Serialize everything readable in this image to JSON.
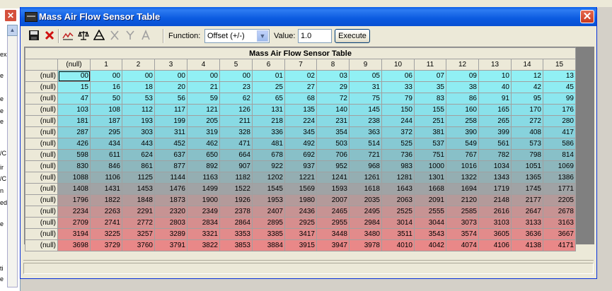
{
  "background": {
    "left_fragments": [
      "ex",
      "e",
      "e",
      "e",
      "e",
      "/C",
      "ir",
      "/C",
      "n",
      "ed",
      "e",
      "ti",
      "e"
    ]
  },
  "window": {
    "title": "Mass Air Flow Sensor Table",
    "close_glyph": "✕"
  },
  "toolbar": {
    "function_label": "Function:",
    "function_value": "Offset (+/-)",
    "value_label": "Value:",
    "value": "1.0",
    "execute_label": "Execute",
    "icons": [
      "save-icon",
      "delete-icon",
      "graph-icon",
      "balance-icon",
      "triangle-icon",
      "x-axis-icon",
      "y-axis-icon",
      "a-icon"
    ]
  },
  "table": {
    "caption": "Mass Air Flow Sensor Table",
    "corner_label": "(null)",
    "columns": [
      "1",
      "2",
      "3",
      "4",
      "5",
      "6",
      "7",
      "8",
      "9",
      "10",
      "11",
      "12",
      "13",
      "14",
      "15"
    ],
    "row_label": "(null)",
    "rows": [
      [
        "00",
        "00",
        "00",
        "00",
        "00",
        "00",
        "01",
        "02",
        "03",
        "05",
        "06",
        "07",
        "09",
        "10",
        "12",
        "13"
      ],
      [
        "15",
        "16",
        "18",
        "20",
        "21",
        "23",
        "25",
        "27",
        "29",
        "31",
        "33",
        "35",
        "38",
        "40",
        "42",
        "45"
      ],
      [
        "47",
        "50",
        "53",
        "56",
        "59",
        "62",
        "65",
        "68",
        "72",
        "75",
        "79",
        "83",
        "86",
        "91",
        "95",
        "99"
      ],
      [
        "103",
        "108",
        "112",
        "117",
        "121",
        "126",
        "131",
        "135",
        "140",
        "145",
        "150",
        "155",
        "160",
        "165",
        "170",
        "176"
      ],
      [
        "181",
        "187",
        "193",
        "199",
        "205",
        "211",
        "218",
        "224",
        "231",
        "238",
        "244",
        "251",
        "258",
        "265",
        "272",
        "280"
      ],
      [
        "287",
        "295",
        "303",
        "311",
        "319",
        "328",
        "336",
        "345",
        "354",
        "363",
        "372",
        "381",
        "390",
        "399",
        "408",
        "417"
      ],
      [
        "426",
        "434",
        "443",
        "452",
        "462",
        "471",
        "481",
        "492",
        "503",
        "514",
        "525",
        "537",
        "549",
        "561",
        "573",
        "586"
      ],
      [
        "598",
        "611",
        "624",
        "637",
        "650",
        "664",
        "678",
        "692",
        "706",
        "721",
        "736",
        "751",
        "767",
        "782",
        "798",
        "814"
      ],
      [
        "830",
        "846",
        "861",
        "877",
        "892",
        "907",
        "922",
        "937",
        "952",
        "968",
        "983",
        "1000",
        "1016",
        "1034",
        "1051",
        "1069"
      ],
      [
        "1088",
        "1106",
        "1125",
        "1144",
        "1163",
        "1182",
        "1202",
        "1221",
        "1241",
        "1261",
        "1281",
        "1301",
        "1322",
        "1343",
        "1365",
        "1386"
      ],
      [
        "1408",
        "1431",
        "1453",
        "1476",
        "1499",
        "1522",
        "1545",
        "1569",
        "1593",
        "1618",
        "1643",
        "1668",
        "1694",
        "1719",
        "1745",
        "1771"
      ],
      [
        "1796",
        "1822",
        "1848",
        "1873",
        "1900",
        "1926",
        "1953",
        "1980",
        "2007",
        "2035",
        "2063",
        "2091",
        "2120",
        "2148",
        "2177",
        "2205"
      ],
      [
        "2234",
        "2263",
        "2291",
        "2320",
        "2349",
        "2378",
        "2407",
        "2436",
        "2465",
        "2495",
        "2525",
        "2555",
        "2585",
        "2616",
        "2647",
        "2678"
      ],
      [
        "2709",
        "2741",
        "2772",
        "2803",
        "2834",
        "2864",
        "2895",
        "2925",
        "2955",
        "2984",
        "3014",
        "3044",
        "3073",
        "3103",
        "3133",
        "3163"
      ],
      [
        "3194",
        "3225",
        "3257",
        "3289",
        "3321",
        "3353",
        "3385",
        "3417",
        "3448",
        "3480",
        "3511",
        "3543",
        "3574",
        "3605",
        "3636",
        "3667"
      ],
      [
        "3698",
        "3729",
        "3760",
        "3791",
        "3822",
        "3853",
        "3884",
        "3915",
        "3947",
        "3978",
        "4010",
        "4042",
        "4074",
        "4106",
        "4138",
        "4171"
      ]
    ],
    "row_colors": [
      "#91f0f4",
      "#8fecf2",
      "#8ce7ef",
      "#89e1ea",
      "#88dae4",
      "#87d2dc",
      "#86c9d3",
      "#88c0c8",
      "#8db7bd",
      "#94aeb2",
      "#a0a3a5",
      "#b49a9a",
      "#c79393",
      "#d68e8e",
      "#e28b8b",
      "#e98888"
    ],
    "selected_cell": [
      0,
      0
    ]
  }
}
